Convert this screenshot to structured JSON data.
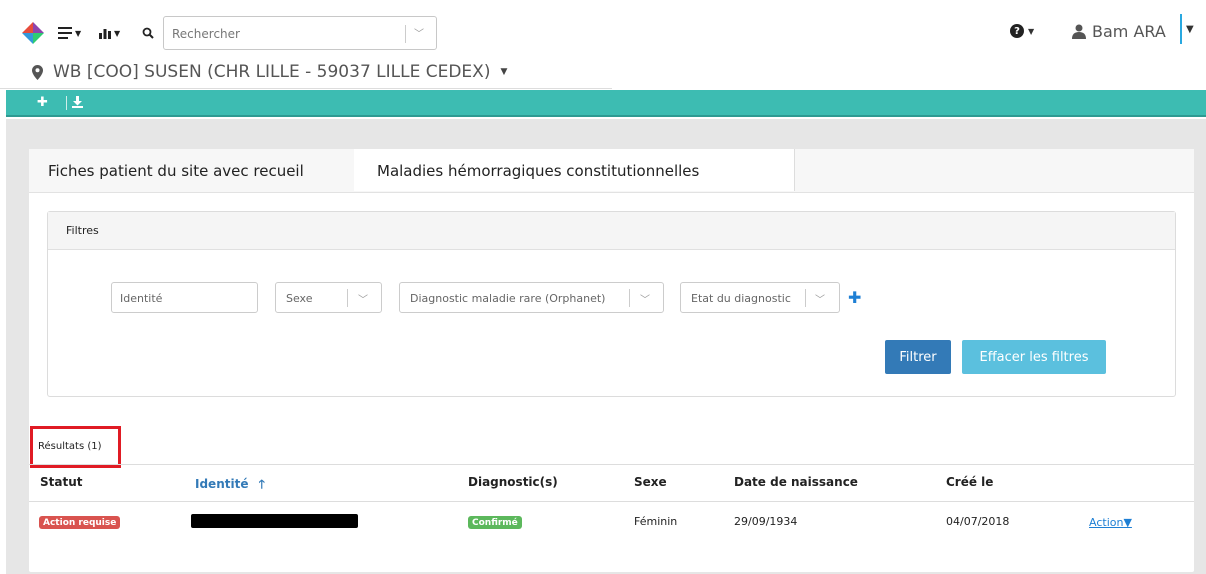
{
  "header": {
    "search_placeholder": "Rechercher",
    "user_name": "Bam ARA",
    "site_label": "WB [COO] SUSEN (CHR LILLE - 59037 LILLE CEDEX)"
  },
  "panel": {
    "title": "Fiches patient du site avec recueil",
    "tab_label": "Maladies hémorragiques constitutionnelles"
  },
  "filters": {
    "heading": "Filtres",
    "identite_placeholder": "Identité",
    "sexe_label": "Sexe",
    "diagnostic_label": "Diagnostic maladie rare (Orphanet)",
    "etat_label": "Etat du diagnostic",
    "filter_button": "Filtrer",
    "clear_button": "Effacer les filtres"
  },
  "results": {
    "label": "Résultats (1)",
    "columns": {
      "statut": "Statut",
      "identite": "Identité",
      "diagnostics": "Diagnostic(s)",
      "sexe": "Sexe",
      "naissance": "Date de naissance",
      "cree": "Créé le"
    },
    "rows": [
      {
        "statut": "Action requise",
        "diagnostic": "Confirmé",
        "sexe": "Féminin",
        "naissance": "29/09/1934",
        "cree": "04/07/2018",
        "action": "Action"
      }
    ]
  },
  "colors": {
    "teal_bar": "#3dbcb2",
    "primary_button": "#337ab7",
    "info_button": "#5bc0de",
    "danger_badge": "#d9534f",
    "success_badge": "#5cb85c",
    "highlight_box": "#e01b24"
  }
}
